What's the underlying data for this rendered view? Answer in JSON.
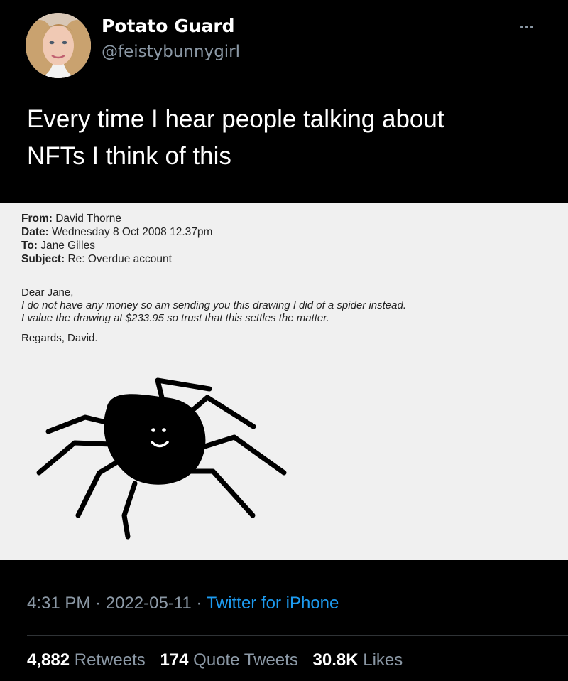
{
  "user": {
    "display_name": "Potato Guard",
    "handle": "@feistybunnygirl"
  },
  "tweet": {
    "text_line1": "Every time I hear people talking about",
    "text_line2": "NFTs I think of this"
  },
  "media": {
    "email": {
      "from_label": "From:",
      "from_value": "David Thorne",
      "date_label": "Date:",
      "date_value": "Wednesday 8 Oct 2008 12.37pm",
      "to_label": "To:",
      "to_value": "Jane Gilles",
      "subject_label": "Subject:",
      "subject_value": "Re: Overdue account",
      "greeting": "Dear Jane,",
      "line1": "I do not have any money so am sending you this drawing I did of a spider instead.",
      "line2": "I value the drawing at $233.95 so trust that this settles the matter.",
      "signoff": "Regards, David."
    }
  },
  "footer": {
    "time": "4:31 PM",
    "separator": "·",
    "date": "2022-05-11",
    "source": "Twitter for iPhone",
    "retweets_count": "4,882",
    "retweets_label": "Retweets",
    "quotes_count": "174",
    "quotes_label": "Quote Tweets",
    "likes_count": "30.8K",
    "likes_label": "Likes"
  },
  "colors": {
    "background": "#000000",
    "text_primary": "#ffffff",
    "text_secondary": "#8b98a5",
    "link": "#1d9bf0",
    "divider": "#2f3336"
  },
  "icons": {
    "more": "more-dots-icon"
  }
}
